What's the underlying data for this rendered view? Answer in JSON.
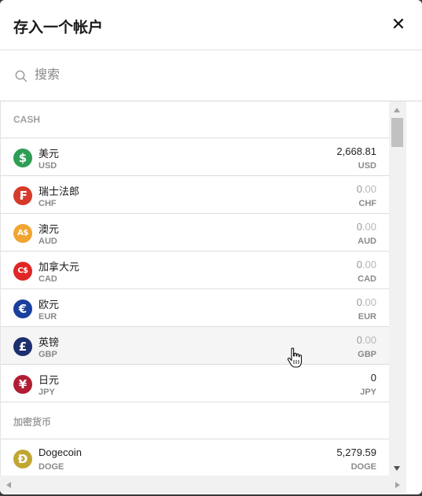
{
  "dialog": {
    "title": "存入一个帐户",
    "close_label": "✕"
  },
  "search": {
    "placeholder": "搜索",
    "value": ""
  },
  "sections": [
    {
      "header": "CASH",
      "rows": [
        {
          "name": "美元",
          "code": "USD",
          "int": "2,668.81",
          "dec": "",
          "zero": false,
          "currency": "USD",
          "icon": "dollar-icon",
          "glyph": "$",
          "color": "#2e9e55"
        },
        {
          "name": "瑞士法郎",
          "code": "CHF",
          "int": "0",
          "dec": ".00",
          "zero": true,
          "currency": "CHF",
          "icon": "franc-icon",
          "glyph": "₣",
          "color": "#d63a2a"
        },
        {
          "name": "澳元",
          "code": "AUD",
          "int": "0",
          "dec": ".00",
          "zero": true,
          "currency": "AUD",
          "icon": "aud-icon",
          "glyph": "A$",
          "color": "#f0a531"
        },
        {
          "name": "加拿大元",
          "code": "CAD",
          "int": "0",
          "dec": ".00",
          "zero": true,
          "currency": "CAD",
          "icon": "cad-icon",
          "glyph": "C$",
          "color": "#e02626"
        },
        {
          "name": "欧元",
          "code": "EUR",
          "int": "0",
          "dec": ".00",
          "zero": true,
          "currency": "EUR",
          "icon": "euro-icon",
          "glyph": "€",
          "color": "#1a3f9c"
        },
        {
          "name": "英镑",
          "code": "GBP",
          "int": "0",
          "dec": ".00",
          "zero": true,
          "currency": "GBP",
          "icon": "pound-icon",
          "glyph": "£",
          "color": "#1c2f6e",
          "hover": true
        },
        {
          "name": "日元",
          "code": "JPY",
          "int": "0",
          "dec": "",
          "zero": false,
          "currency": "JPY",
          "icon": "yen-icon",
          "glyph": "¥",
          "color": "#b01d35"
        }
      ]
    },
    {
      "header": "加密货币",
      "rows": [
        {
          "name": "Dogecoin",
          "code": "DOGE",
          "int": "5,279.59",
          "dec": "",
          "zero": false,
          "currency": "DOGE",
          "icon": "dogecoin-icon",
          "glyph": "Ð",
          "color": "#c2a633"
        }
      ]
    }
  ]
}
